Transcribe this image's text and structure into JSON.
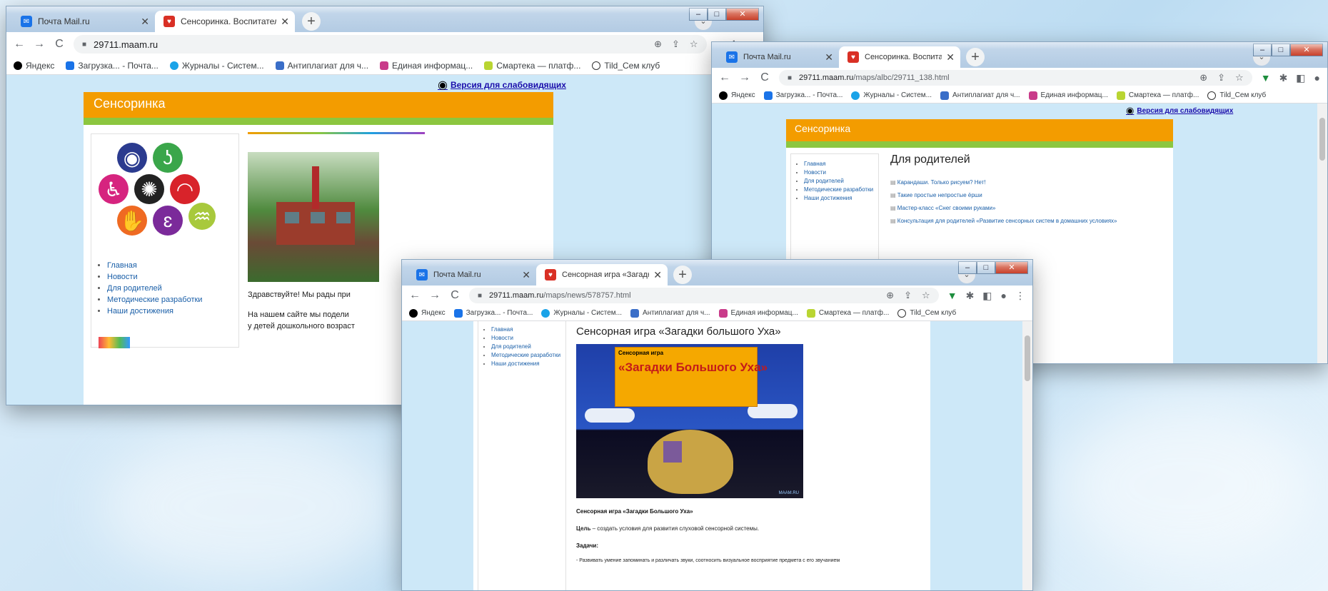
{
  "win1": {
    "tabs": [
      {
        "label": "Почта Mail.ru",
        "kind": "mail"
      },
      {
        "label": "Сенсоринка. Воспитателям дет",
        "kind": "maam"
      }
    ],
    "url_host": "29711.maam.ru",
    "url_path": "",
    "bookmarks": [
      "Яндекс",
      "Загрузка... - Почта...",
      "Журналы - Систем...",
      "Антиплагиат для ч...",
      "Единая информац...",
      "Смартека — платф...",
      "Tild_Сем клуб"
    ],
    "vision_link": "Версия для слабовидящих",
    "site_name": "Сенсоринка",
    "menu": [
      "Главная",
      "Новости",
      "Для родителей",
      "Методические разработки",
      "Наши достижения"
    ],
    "welcome": "Здравствуйте! Мы рады при",
    "about_line1": "На нашем сайте мы подели",
    "about_line2": "у детей дошкольного возраст"
  },
  "win2": {
    "tabs": [
      {
        "label": "Почта Mail.ru",
        "kind": "mail"
      },
      {
        "label": "Сенсоринка. Воспитателям де",
        "kind": "maam"
      }
    ],
    "url_host": "29711.maam.ru",
    "url_path": "/maps/albc/29711_138.html",
    "bookmarks": [
      "Яндекс",
      "Загрузка... - Почта...",
      "Журналы - Систем...",
      "Антиплагиат для ч...",
      "Единая информац...",
      "Смартека — платф...",
      "Tild_Сем клуб"
    ],
    "vision_link": "Версия для слабовидящих",
    "site_name": "Сенсоринка",
    "menu": [
      "Главная",
      "Новости",
      "Для родителей",
      "Методические разработки",
      "Наши достижения"
    ],
    "heading": "Для родителей",
    "links": [
      "Карандаши. Только рисуем? Нет!",
      "Такие простые непростые ёрши",
      "Мастер-класс «Снег своими руками»",
      "Консультация для родителей «Развитие сенсорных систем в домашних условиях»"
    ]
  },
  "win3": {
    "tabs": [
      {
        "label": "Почта Mail.ru",
        "kind": "mail"
      },
      {
        "label": "Сенсорная игра «Загадки боль",
        "kind": "maam"
      }
    ],
    "url_host": "29711.maam.ru",
    "url_path": "/maps/news/578757.html",
    "bookmarks": [
      "Яндекс",
      "Загрузка... - Почта...",
      "Журналы - Систем...",
      "Антиплагиат для ч...",
      "Единая информац...",
      "Смартека — платф...",
      "Tild_Сем клуб"
    ],
    "menu": [
      "Главная",
      "Новости",
      "Для родителей",
      "Методические разработки",
      "Наши достижения"
    ],
    "article_title": "Сенсорная игра «Загадки большого Уха»",
    "poster_small": "Сенсорная игра",
    "poster_big": "«Загадки Большого Уха»",
    "caption": "Сенсорная игра «Загадки Большого Уха»",
    "goal_label": "Цель",
    "goal_text": " – создать условия для развития слуховой сенсорной системы.",
    "tasks_label": "Задачи:",
    "task_text": "- Развивать умение запоминать и различать звуки, соотносить визуальное восприятие предмета с его звучанием"
  },
  "colors": {
    "header_orange": "#f39c00",
    "stripe_green": "#8cc63f",
    "page_blue": "#cde8f8",
    "link_blue": "#1a5fa8"
  }
}
